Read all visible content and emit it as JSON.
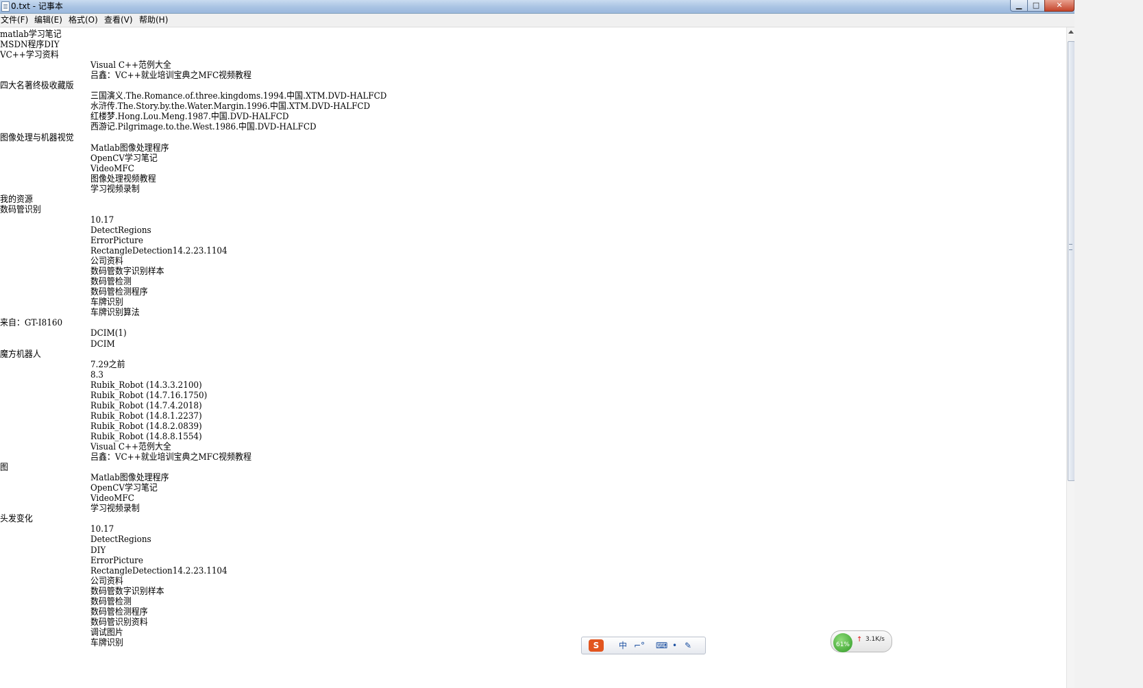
{
  "window": {
    "title": "0.txt - 记事本",
    "min_glyph": "▁",
    "max_glyph": "□",
    "close_glyph": "✕"
  },
  "menu": [
    "文件(F)",
    "编辑(E)",
    "格式(O)",
    "查看(V)",
    "帮助(H)"
  ],
  "lines": [
    {
      "text": "matlab学习笔记",
      "indent": false
    },
    {
      "text": "MSDN程序DIY",
      "indent": false
    },
    {
      "text": "VC++学习资料",
      "indent": false
    },
    {
      "text": "Visual C++范例大全",
      "indent": true
    },
    {
      "text": "吕鑫：VC++就业培训宝典之MFC视频教程",
      "indent": true
    },
    {
      "text": "四大名著终极收藏版",
      "indent": false
    },
    {
      "text": "三国演义.The.Romance.of.three.kingdoms.1994.中国.XTM.DVD-HALFCD",
      "indent": true
    },
    {
      "text": "水浒传.The.Story.by.the.Water.Margin.1996.中国.XTM.DVD-HALFCD",
      "indent": true
    },
    {
      "text": "红楼梦.Hong.Lou.Meng.1987.中国.DVD-HALFCD",
      "indent": true
    },
    {
      "text": "西游记.Pilgrimage.to.the.West.1986.中国.DVD-HALFCD",
      "indent": true
    },
    {
      "text": "图像处理与机器视觉",
      "indent": false
    },
    {
      "text": "Matlab图像处理程序",
      "indent": true
    },
    {
      "text": "OpenCV学习笔记",
      "indent": true
    },
    {
      "text": "VideoMFC",
      "indent": true
    },
    {
      "text": "图像处理视频教程",
      "indent": true
    },
    {
      "text": "学习视频录制",
      "indent": true
    },
    {
      "text": "我的资源",
      "indent": false
    },
    {
      "text": "数码管识别",
      "indent": false
    },
    {
      "text": "10.17",
      "indent": true
    },
    {
      "text": "DetectRegions",
      "indent": true
    },
    {
      "text": "ErrorPicture",
      "indent": true
    },
    {
      "text": "RectangleDetection14.2.23.1104",
      "indent": true
    },
    {
      "text": "公司资料",
      "indent": true
    },
    {
      "text": "数码管数字识别样本",
      "indent": true
    },
    {
      "text": "数码管检测",
      "indent": true
    },
    {
      "text": "数码管检测程序",
      "indent": true
    },
    {
      "text": "车牌识别",
      "indent": true
    },
    {
      "text": "车牌识别算法",
      "indent": true
    },
    {
      "text": "来自：GT-I8160",
      "indent": false
    },
    {
      "text": "DCIM(1)",
      "indent": true
    },
    {
      "text": "DCIM",
      "indent": true
    },
    {
      "text": "魔方机器人",
      "indent": false
    },
    {
      "text": "7.29之前",
      "indent": true
    },
    {
      "text": "8.3",
      "indent": true
    },
    {
      "text": "Rubik_Robot (14.3.3.2100)",
      "indent": true
    },
    {
      "text": "Rubik_Robot (14.7.16.1750)",
      "indent": true
    },
    {
      "text": "Rubik_Robot (14.7.4.2018)",
      "indent": true
    },
    {
      "text": "Rubik_Robot (14.8.1.2237)",
      "indent": true
    },
    {
      "text": "Rubik_Robot (14.8.2.0839)",
      "indent": true
    },
    {
      "text": "Rubik_Robot (14.8.8.1554)",
      "indent": true
    },
    {
      "text": "Visual C++范例大全",
      "indent": true
    },
    {
      "text": "吕鑫：VC++就业培训宝典之MFC视频教程",
      "indent": true
    },
    {
      "text": "图",
      "indent": false
    },
    {
      "text": "Matlab图像处理程序",
      "indent": true
    },
    {
      "text": "OpenCV学习笔记",
      "indent": true
    },
    {
      "text": "VideoMFC",
      "indent": true
    },
    {
      "text": "学习视频录制",
      "indent": true
    },
    {
      "text": "头发变化",
      "indent": false
    },
    {
      "text": "10.17",
      "indent": true
    },
    {
      "text": "DetectRegions",
      "indent": true
    },
    {
      "text": "DIY",
      "indent": true
    },
    {
      "text": "ErrorPicture",
      "indent": true
    },
    {
      "text": "RectangleDetection14.2.23.1104",
      "indent": true
    },
    {
      "text": "公司资料",
      "indent": true
    },
    {
      "text": "数码管数字识别样本",
      "indent": true
    },
    {
      "text": "数码管检测",
      "indent": true
    },
    {
      "text": "数码管检测程序",
      "indent": true
    },
    {
      "text": "数码管识别资料",
      "indent": true
    },
    {
      "text": "调试图片",
      "indent": true
    },
    {
      "text": "车牌识别",
      "indent": true
    }
  ],
  "ime": {
    "logo": "S",
    "items": [
      "中",
      "⌐°",
      "⌨",
      "•",
      "✎"
    ]
  },
  "net": {
    "percent": "61%",
    "arrow": "↑",
    "speed": "3.1K/s"
  }
}
